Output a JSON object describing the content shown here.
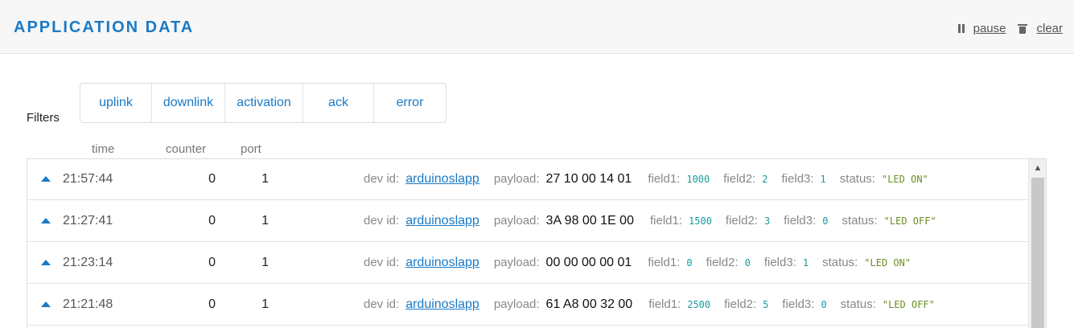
{
  "header": {
    "title": "APPLICATION DATA",
    "pause_label": "pause",
    "clear_label": "clear"
  },
  "filters": {
    "label": "Filters",
    "items": [
      "uplink",
      "downlink",
      "activation",
      "ack",
      "error"
    ]
  },
  "columns": {
    "time": "time",
    "counter": "counter",
    "port": "port"
  },
  "detail_labels": {
    "dev_id": "dev id:",
    "payload": "payload:",
    "field1": "field1:",
    "field2": "field2:",
    "field3": "field3:",
    "status": "status:"
  },
  "rows": [
    {
      "time": "21:57:44",
      "counter": "0",
      "port": "1",
      "dev_id": "arduinoslapp",
      "payload": "27 10 00 14 01",
      "field1": "1000",
      "field2": "2",
      "field3": "1",
      "status": "\"LED ON\""
    },
    {
      "time": "21:27:41",
      "counter": "0",
      "port": "1",
      "dev_id": "arduinoslapp",
      "payload": "3A 98 00 1E 00",
      "field1": "1500",
      "field2": "3",
      "field3": "0",
      "status": "\"LED OFF\""
    },
    {
      "time": "21:23:14",
      "counter": "0",
      "port": "1",
      "dev_id": "arduinoslapp",
      "payload": "00 00 00 00 01",
      "field1": "0",
      "field2": "0",
      "field3": "1",
      "status": "\"LED ON\""
    },
    {
      "time": "21:21:48",
      "counter": "0",
      "port": "1",
      "dev_id": "arduinoslapp",
      "payload": "61 A8 00 32 00",
      "field1": "2500",
      "field2": "5",
      "field3": "0",
      "status": "\"LED OFF\""
    }
  ],
  "icons": {
    "pause": "pause-icon",
    "clear": "trash-icon",
    "row_expand": "triangle-up-icon",
    "scroll_up": "chevron-up-icon"
  },
  "colors": {
    "accent": "#1a7ac6",
    "number_value": "#1a9b9b",
    "string_value": "#6b8e23"
  }
}
